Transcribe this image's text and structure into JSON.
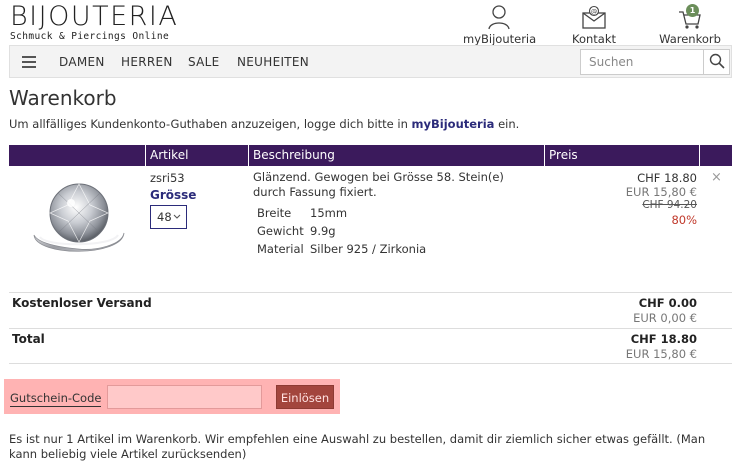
{
  "header": {
    "logo_title": "BIJOUTERIA",
    "logo_subtitle": "Schmuck & Piercings Online",
    "my_label": "myBijouteria",
    "contact_label": "Kontakt",
    "cart_label": "Warenkorb",
    "cart_count": "1"
  },
  "nav": {
    "items": [
      "DAMEN",
      "HERREN",
      "SALE",
      "NEUHEITEN"
    ],
    "search_placeholder": "Suchen"
  },
  "page": {
    "title": "Warenkorb",
    "notice_before": "Um allfälliges Kundenkonto-Guthaben anzuzeigen, logge dich bitte in ",
    "notice_link": "myBijouteria",
    "notice_after": " ein."
  },
  "table": {
    "headers": [
      "Artikel",
      "Beschreibung",
      "Preis"
    ]
  },
  "item": {
    "sku": "zsri53",
    "size_label": "Grösse",
    "size_value": "48",
    "description": "Glänzend. Gewogen bei Grösse 58. Stein(e) durch Fassung fixiert.",
    "attributes": [
      {
        "label": "Breite",
        "value": "15mm"
      },
      {
        "label": "Gewicht",
        "value": "9.9g"
      },
      {
        "label": "Material",
        "value": "Silber 925 / Zirkonia"
      }
    ],
    "price_chf": "CHF 18.80",
    "price_eur": "EUR 15,80 €",
    "old_price": "CHF 94.20",
    "discount": "80%",
    "remove_symbol": "×"
  },
  "summary": {
    "shipping_label": "Kostenloser Versand",
    "shipping_chf": "CHF 0.00",
    "shipping_eur": "EUR 0,00 €",
    "total_label": "Total",
    "total_chf": "CHF 18.80",
    "total_eur": "EUR 15,80 €"
  },
  "coupon": {
    "label": "Gutschein-Code",
    "value": "",
    "button": "Einlösen"
  },
  "footer_note": "Es ist nur 1 Artikel im Warenkorb. Wir empfehlen eine Auswahl zu bestellen, damit dir ziemlich sicher etwas gefällt. (Man kann beliebig viele Artikel zurücksenden)",
  "colors": {
    "header_bar": "#3b1a5c",
    "link": "#2b2b7a",
    "discount": "#c0392b",
    "coupon_highlight": "#ffb3b3",
    "coupon_button": "#a3453d",
    "cart_badge": "#6b8e5a"
  },
  "icons": {
    "account": "user-icon",
    "contact": "envelope-icon",
    "cart": "cart-icon",
    "menu": "hamburger-icon",
    "search": "search-icon"
  }
}
